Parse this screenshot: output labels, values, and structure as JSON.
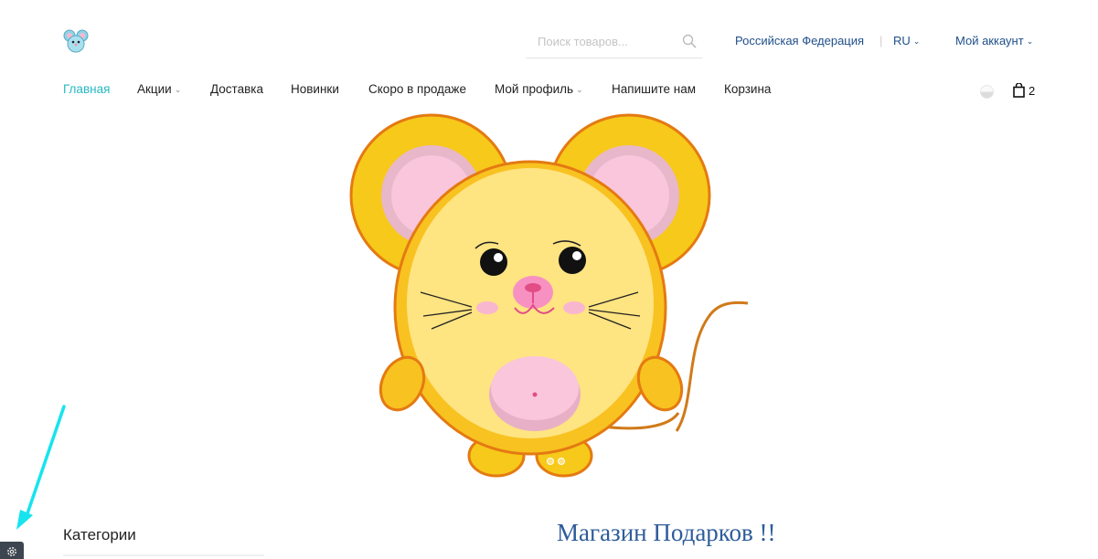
{
  "header": {
    "search_placeholder": "Поиск товаров...",
    "region": "Российская Федерация",
    "separator": "|",
    "language": "RU",
    "account": "Мой аккаунт"
  },
  "nav": {
    "items": [
      {
        "label": "Главная",
        "active": true
      },
      {
        "label": "Акции",
        "dropdown": true
      },
      {
        "label": "Доставка"
      },
      {
        "label": "Новинки"
      },
      {
        "label": "Скоро в продаже"
      },
      {
        "label": "Мой профиль",
        "dropdown": true
      },
      {
        "label": "Напишите нам"
      },
      {
        "label": "Корзина"
      }
    ],
    "cart_count": "2"
  },
  "hero": {
    "image": "cartoon-yellow-mouse",
    "slides": 2
  },
  "sidebar": {
    "categories_title": "Категории"
  },
  "main": {
    "shop_title": "Магазин Подарков !!"
  },
  "colors": {
    "accent": "#27b8c4",
    "link": "#1f4f8a",
    "shop_title": "#2e5c9a",
    "settings_button": "#3d4650",
    "annotation_arrow": "#16e4ee"
  },
  "icons": [
    "mouse-logo-icon",
    "search-icon",
    "chevron-down-icon",
    "theme-toggle-icon",
    "shopping-bag-icon",
    "gear-icon",
    "arrow-annotation-icon"
  ]
}
